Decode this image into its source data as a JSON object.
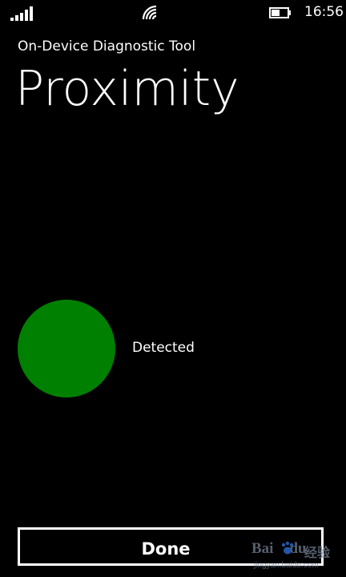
{
  "status_bar": {
    "signal_icon": "signal-bars-icon",
    "wifi_icon": "wifi-icon",
    "battery_icon": "battery-icon",
    "time": "16:56"
  },
  "header": {
    "app_name": "On-Device Diagnostic Tool",
    "page_title": "Proximity"
  },
  "sensor": {
    "status_text": "Detected",
    "indicator_color": "#008000"
  },
  "actions": {
    "done_label": "Done"
  },
  "watermark": {
    "brand_left": "Bai",
    "brand_right": "du",
    "tag": "经验",
    "url": "jingyan.baidu.com"
  },
  "colors": {
    "background": "#000000",
    "foreground": "#ffffff",
    "indicator": "#008000"
  }
}
